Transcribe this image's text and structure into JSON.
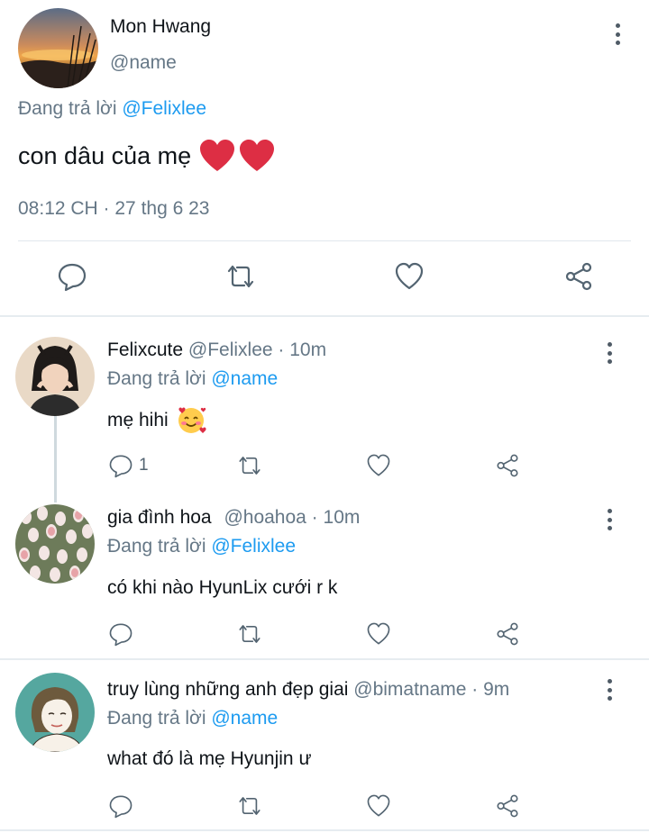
{
  "main_tweet": {
    "author_name": "Mon Hwang",
    "author_handle": "@name",
    "replying_to_prefix": "Đang trả lời",
    "replying_to_mention": "@Felixlee",
    "text": "con dâu của mẹ",
    "emoji": "❤️❤️",
    "timestamp": "08:12 CH · 27 thg 6 23",
    "actions": [
      "reply-icon",
      "retweet-icon",
      "like-icon",
      "share-icon"
    ]
  },
  "replies": [
    {
      "name": "Felixcute",
      "handle_time": "@Felixlee · 10m",
      "replying_to_prefix": "Đang trả lời",
      "replying_to_mention": "@name",
      "text": "mẹ hihi",
      "emoji": "🥰",
      "reply_count": "1"
    },
    {
      "name": "gia đình hoa",
      "handle_time": "@hoahoa · 10m",
      "replying_to_prefix": "Đang trả lời",
      "replying_to_mention": "@Felixlee",
      "text": "có khi nào HyunLix cưới r k",
      "reply_count": ""
    },
    {
      "name": "truy lùng những anh đẹp giai",
      "handle_time": "@bimatname · 9m",
      "replying_to_prefix": "Đang trả lời",
      "replying_to_mention": "@name",
      "text": "what đó là mẹ Hyunjin ư",
      "reply_count": ""
    }
  ],
  "colors": {
    "mention": "#1d9bf0",
    "secondary_text": "#657786",
    "icon": "#536471",
    "heart": "#dd2e44"
  }
}
